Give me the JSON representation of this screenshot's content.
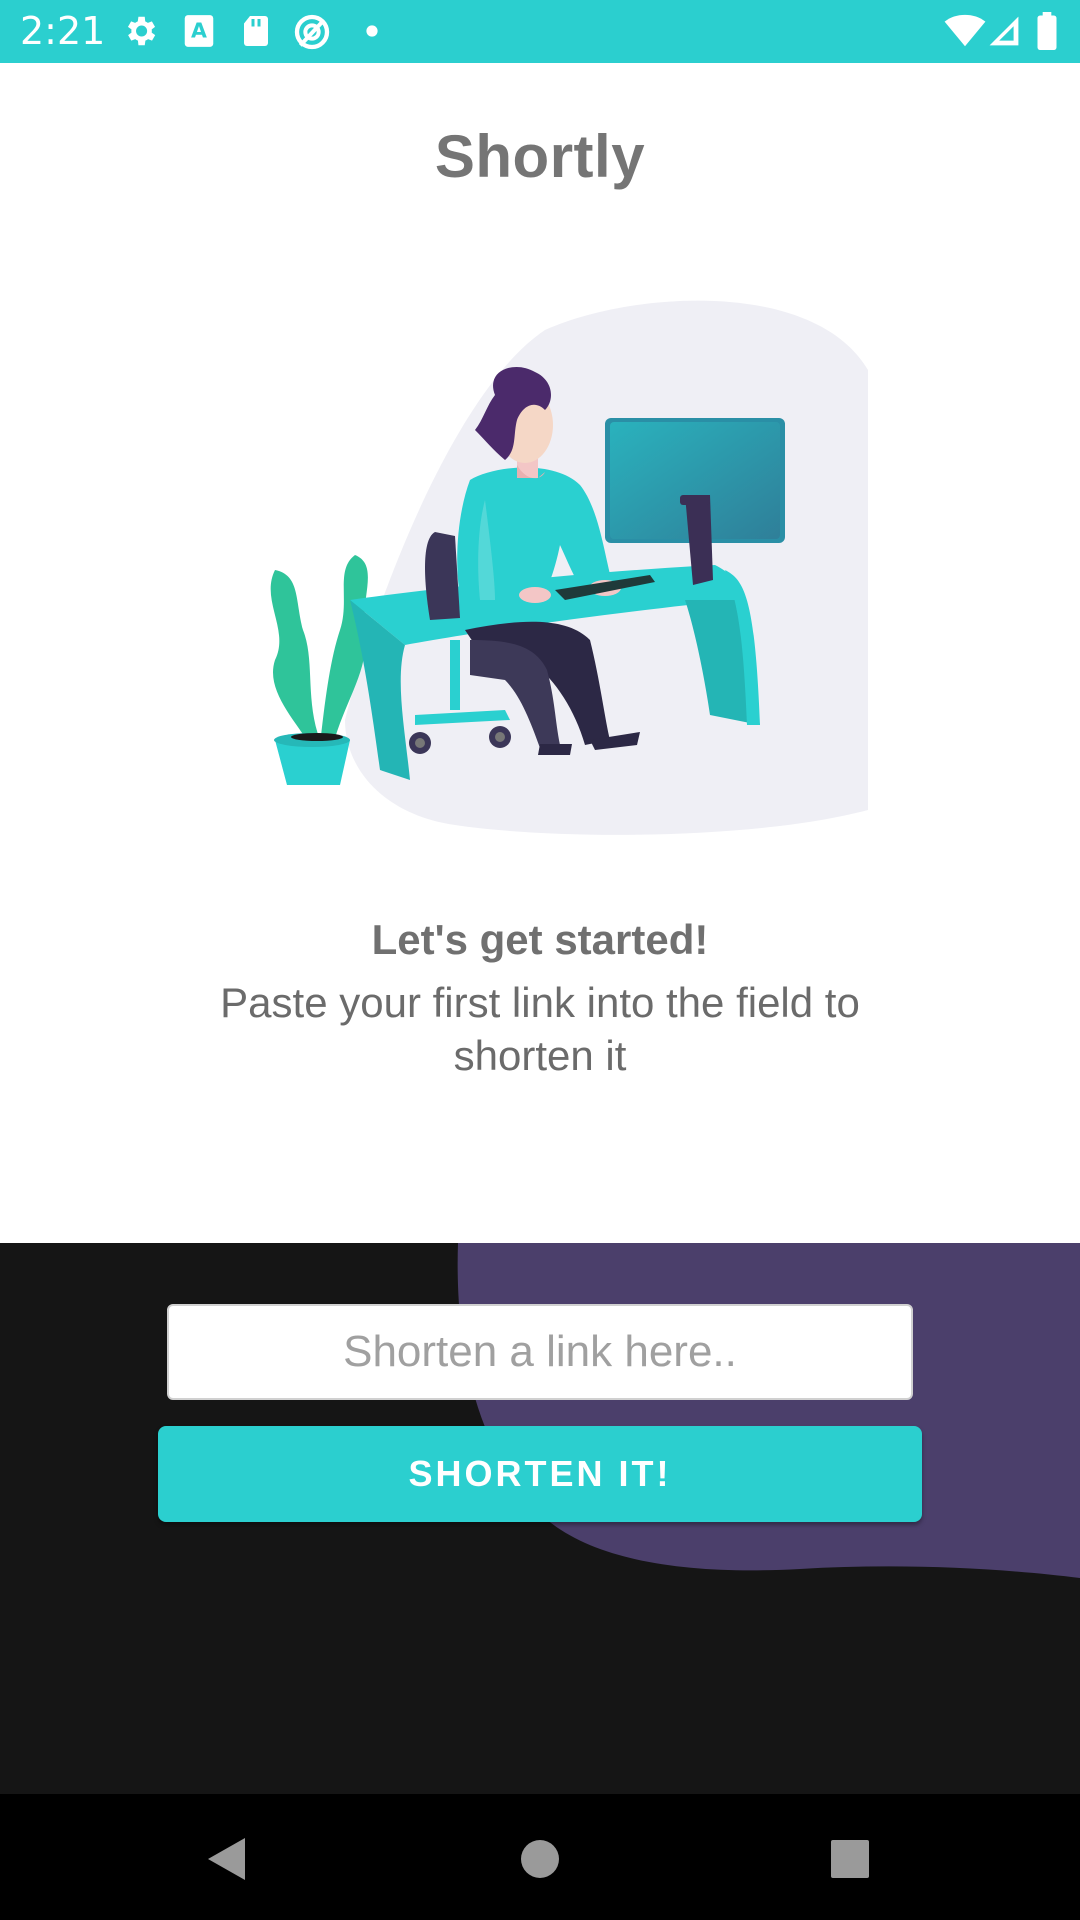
{
  "status_bar": {
    "time": "2:21",
    "left_icons": [
      "gear-icon",
      "font-a-icon",
      "sd-card-icon",
      "location-off-icon",
      "dot-icon"
    ],
    "right_icons": [
      "wifi-icon",
      "signal-icon",
      "battery-icon"
    ]
  },
  "app": {
    "title": "Shortly"
  },
  "empty_state": {
    "heading": "Let's get started!",
    "subtext": "Paste your first link into the field to shorten it"
  },
  "shorten_form": {
    "input_value": "",
    "input_placeholder": "Shorten a link here..",
    "button_label": "SHORTEN IT!"
  },
  "nav_bar": {
    "buttons": [
      "back-icon",
      "home-icon",
      "recents-icon"
    ]
  },
  "colors": {
    "accent": "#2bcfcf",
    "panel_dark": "#151515",
    "panel_purple": "#4b3f6b"
  }
}
